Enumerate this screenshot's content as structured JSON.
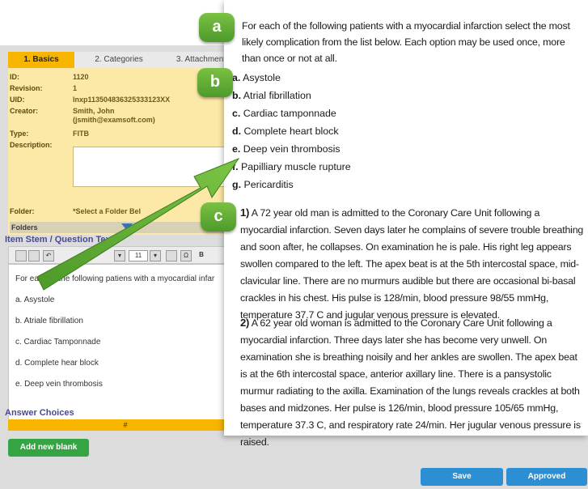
{
  "editor": {
    "tabs": [
      "1. Basics",
      "2. Categories",
      "3. Attachments"
    ],
    "fields": [
      {
        "label": "ID:",
        "value": "1120"
      },
      {
        "label": "Revision:",
        "value": "1"
      },
      {
        "label": "UID:",
        "value": "lnxp113504836325333123XX"
      },
      {
        "label": "Creator:",
        "value": "Smith, John"
      },
      {
        "label": "",
        "value": "(jsmith@examsoft.com)"
      },
      {
        "label": "Type:",
        "value": "FITB"
      },
      {
        "label": "Description:",
        "value": ""
      },
      {
        "label": "Folder:",
        "value": "*Select a Folder Bel"
      }
    ],
    "folders_label": "Folders",
    "stem_title": "Item Stem / Question Text",
    "toolbar_font_size": "11",
    "toolbar_bold": "B",
    "stem_lines": [
      "For each of the following patiens with a myocardial infar",
      "a. Asystole",
      "b. Atriale fibrillation",
      "c. Cardiac Tamponnade",
      "d. Complete hear block",
      "e. Deep vein thrombosis"
    ],
    "answer_choices_title": "Answer Choices",
    "answer_col_header": "#",
    "add_blank_label": "Add new blank",
    "save_label": "Save",
    "approved_label": "Approved"
  },
  "question": {
    "intro": "For each of the following patients with a myocardial infarction select the most likely complication from the list below. Each option may be used once, more than once or not at all.",
    "options": [
      {
        "letter": "a.",
        "text": "Asystole"
      },
      {
        "letter": "b.",
        "text": "Atrial fibrillation"
      },
      {
        "letter": "c.",
        "text": "Cardiac tamponnade"
      },
      {
        "letter": "d.",
        "text": "Complete heart block"
      },
      {
        "letter": "e.",
        "text": "Deep vein thrombosis"
      },
      {
        "letter": "f.",
        "text": "Papilliary muscle rupture"
      },
      {
        "letter": "g.",
        "text": "Pericarditis"
      }
    ],
    "cases": [
      {
        "num": "1)",
        "text": "A 72 year old man is admitted to the Coronary Care Unit following a myocardial infarction. Seven days later he complains of severe trouble breathing and soon after, he collapses. On examination he is pale. His right leg appears swollen compared to the left. The apex beat is at the 5th intercostal space, mid-clavicular line. There are no murmurs audible but there are occasional bi-basal crackles in his chest. His pulse is 128/min, blood pressure 98/55 mmHg, temperature 37.7 C and jugular venous pressure is elevated."
      },
      {
        "num": "2)",
        "text": "A 62 year old woman is admitted to the Coronary Care Unit following a myocardial infarction. Three days later she has become very unwell. On examination she is breathing noisily and her ankles are swollen. The apex beat is at the 6th intercostal space, anterior axillary line. There is a pansystolic murmur radiating to the axilla. Examination of the lungs reveals crackles at both bases and midzones. Her pulse is 126/min, blood pressure 105/65 mmHg, temperature 37.3 C, and respiratory rate 24/min. Her jugular venous pressure is raised."
      }
    ]
  },
  "badges": [
    "a",
    "b",
    "c"
  ],
  "colors": {
    "accent_green": "#5fae35",
    "tab_orange": "#f7b500",
    "button_blue": "#2d8fd3",
    "add_green": "#35a543"
  }
}
